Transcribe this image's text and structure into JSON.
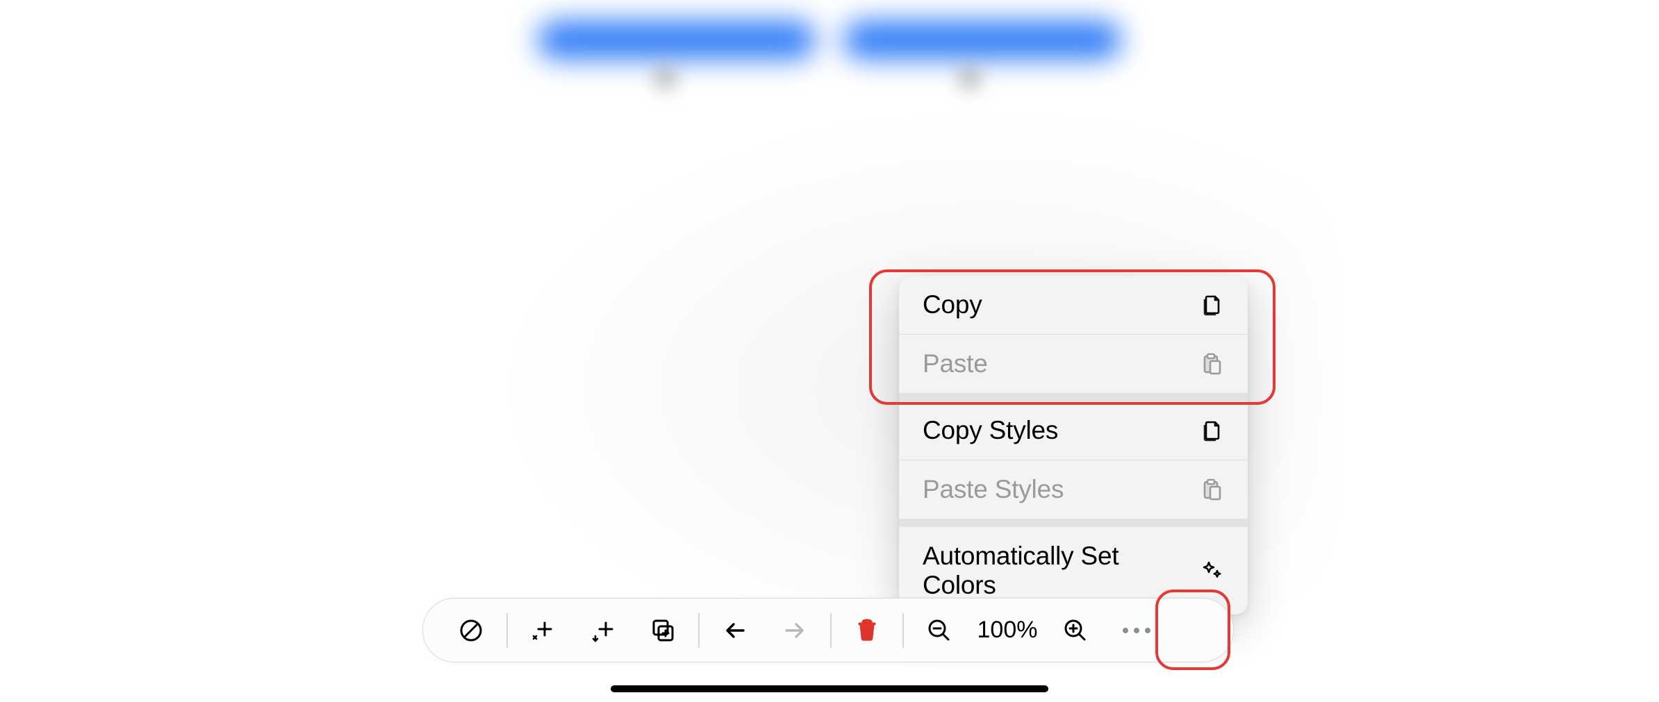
{
  "context_menu": {
    "copy": {
      "label": "Copy",
      "enabled": true,
      "icon": "copy-doc-icon"
    },
    "paste": {
      "label": "Paste",
      "enabled": false,
      "icon": "paste-clipboard-icon"
    },
    "copy_styles": {
      "label": "Copy Styles",
      "enabled": true,
      "icon": "copy-doc-icon"
    },
    "paste_styles": {
      "label": "Paste Styles",
      "enabled": false,
      "icon": "paste-clipboard-icon"
    },
    "auto_colors": {
      "label": "Automatically Set Colors",
      "enabled": true,
      "icon": "sparkle-icon"
    }
  },
  "toolbar": {
    "zoom_label": "100%",
    "undo_enabled": true,
    "redo_enabled": false
  },
  "highlights": {
    "copy_paste_group": true,
    "more_button": true
  }
}
